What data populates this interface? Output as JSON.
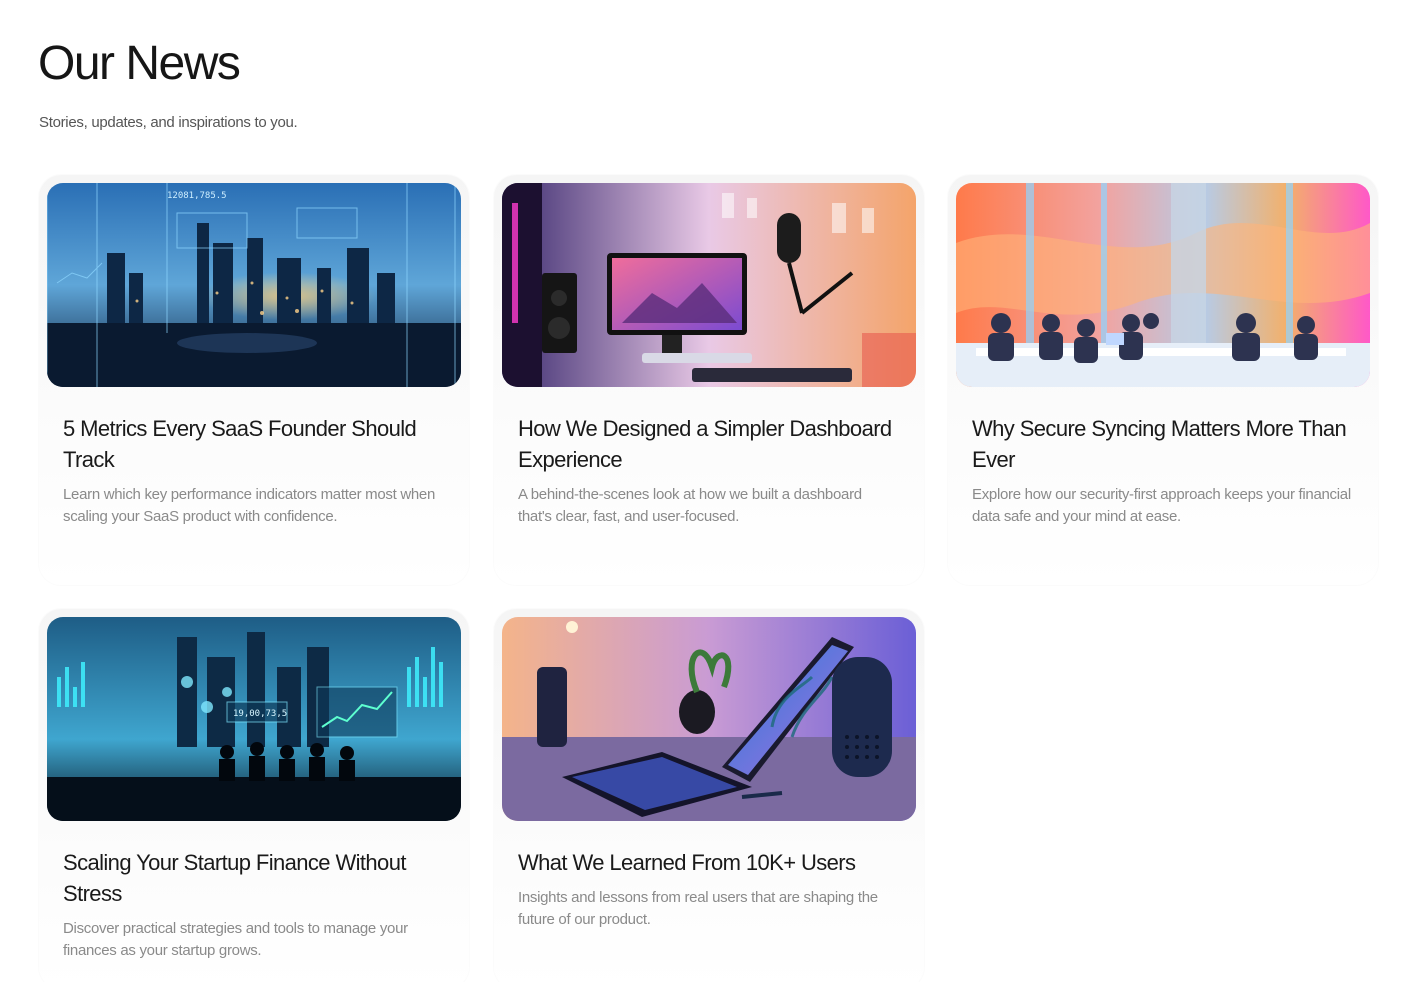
{
  "header": {
    "title": "Our News",
    "subtitle": "Stories, updates, and inspirations to you."
  },
  "posts": [
    {
      "title": "5 Metrics Every SaaS Founder Should Track",
      "description": "Learn which key performance indicators matter most when scaling your SaaS product with confidence.",
      "image": "city-skyline-data-overlay",
      "image_text": "12081,785.5"
    },
    {
      "title": "How We Designed a Simpler Dashboard Experience",
      "description": "A behind-the-scenes look at how we built a dashboard that's clear, fast, and user-focused.",
      "image": "neon-desk-setup-monitor"
    },
    {
      "title": "Why Secure Syncing Matters More Than Ever",
      "description": "Explore how our security-first approach keeps your financial data safe and your mind at ease.",
      "image": "colorful-meeting-room"
    },
    {
      "title": "Scaling Your Startup Finance Without Stress",
      "description": "Discover practical strategies and tools to manage your finances as your startup grows.",
      "image": "team-viewing-financial-charts",
      "image_text": "19,00,73,5"
    },
    {
      "title": "What We Learned From 10K+ Users",
      "description": "Insights and lessons from real users that are shaping the future of our product.",
      "image": "tablet-and-smart-speaker-desk"
    }
  ]
}
